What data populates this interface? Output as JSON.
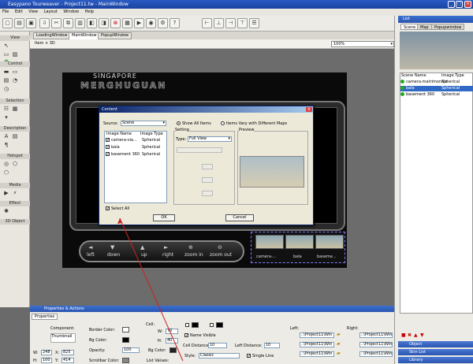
{
  "window": {
    "title": "Easypano Tourweaver - Project11.tw - MainWindow"
  },
  "menu": [
    "File",
    "Edit",
    "View",
    "Layout",
    "Window",
    "Help"
  ],
  "tools_panel": {
    "groups": [
      "View",
      "Control",
      "Selection",
      "Description",
      "Hotspot",
      "Media",
      "Effect",
      "3D Object"
    ]
  },
  "doc_tabs": [
    "LoadingWindow",
    "MainWindow",
    "PopupWindow"
  ],
  "doc_bar": {
    "item_label": "Item + 3D",
    "zoom": "100%"
  },
  "tour": {
    "brand_line1": "SINGAPORE",
    "brand_line2": "MERGHUGUAN",
    "nav_labels": [
      "left",
      "down",
      "up",
      "right",
      "zoom in",
      "zoom out"
    ],
    "thumb_labels": [
      "camera-...",
      "bala",
      "baseme..."
    ]
  },
  "dialog": {
    "title": "Content",
    "source_label": "Source:",
    "source_value": "Scene",
    "show_all_label": "Show All Items",
    "items_vary_label": "Items Vary with Different Maps",
    "col_image_name": "Image Name",
    "col_image_type": "Image Type",
    "rows": [
      {
        "name": "camera-via...",
        "type": "Spherical"
      },
      {
        "name": "bala",
        "type": "Spherical"
      },
      {
        "name": "basement 360",
        "type": "Spherical"
      }
    ],
    "setting_label": "Setting",
    "type_label": "Type:",
    "type_value": "Full View",
    "preview_label": "Preview",
    "select_all_label": "Select All",
    "ok_label": "OK",
    "cancel_label": "Cancel"
  },
  "right_panel": {
    "header": "List",
    "tabs": [
      "Scene",
      "Map",
      "Popupwindow"
    ],
    "col_scene_name": "Scene Name",
    "col_image_type": "Image Type",
    "scenes": [
      {
        "name": "camera-matrimonala",
        "type": "Spherical"
      },
      {
        "name": "bala",
        "type": "Spherical"
      },
      {
        "name": "basement 360",
        "type": "Spherical"
      }
    ],
    "bottom_bars": [
      "Object",
      "Skin List",
      "Library"
    ]
  },
  "properties": {
    "header": "Properties & Actions",
    "tab": "Properties",
    "component_label": "Component:",
    "component_value": "Thumbnail",
    "border_color_label": "Border Color:",
    "bg_color_label": "Bg Color:",
    "opacity_label": "Opacity:",
    "opacity_value": "100",
    "scrollbar_color_label": "Scrollbar Color:",
    "cell_label": "Cell:",
    "cell_w_label": "W:",
    "cell_w_value": "70",
    "cell_h_label": "H:",
    "cell_h_value": "40",
    "cell_bg_color_label": "Bg Color:",
    "list_values_label": "List Values:",
    "name_visible_label": "Name Visible",
    "cell_distance_label": "Cell Distance:",
    "cell_distance_value": "10",
    "left_distance_label": "Left Distance:",
    "left_distance_value": "10",
    "style_label": "Style:",
    "style_value": "Classic",
    "single_line_label": "Single Line",
    "left_label": "Left:",
    "right_label": "Right:",
    "path_value": "..\\Project11\\Win",
    "x_label": "X:",
    "x_value": "825",
    "y_label": "Y:",
    "y_value": "414",
    "w_label": "W:",
    "w_value": "248",
    "h_label": "H:",
    "h_value": "100"
  },
  "colors": {
    "accent": "#316ac5",
    "titlebar": "#1a43a0",
    "annotation": "#cc2222"
  }
}
